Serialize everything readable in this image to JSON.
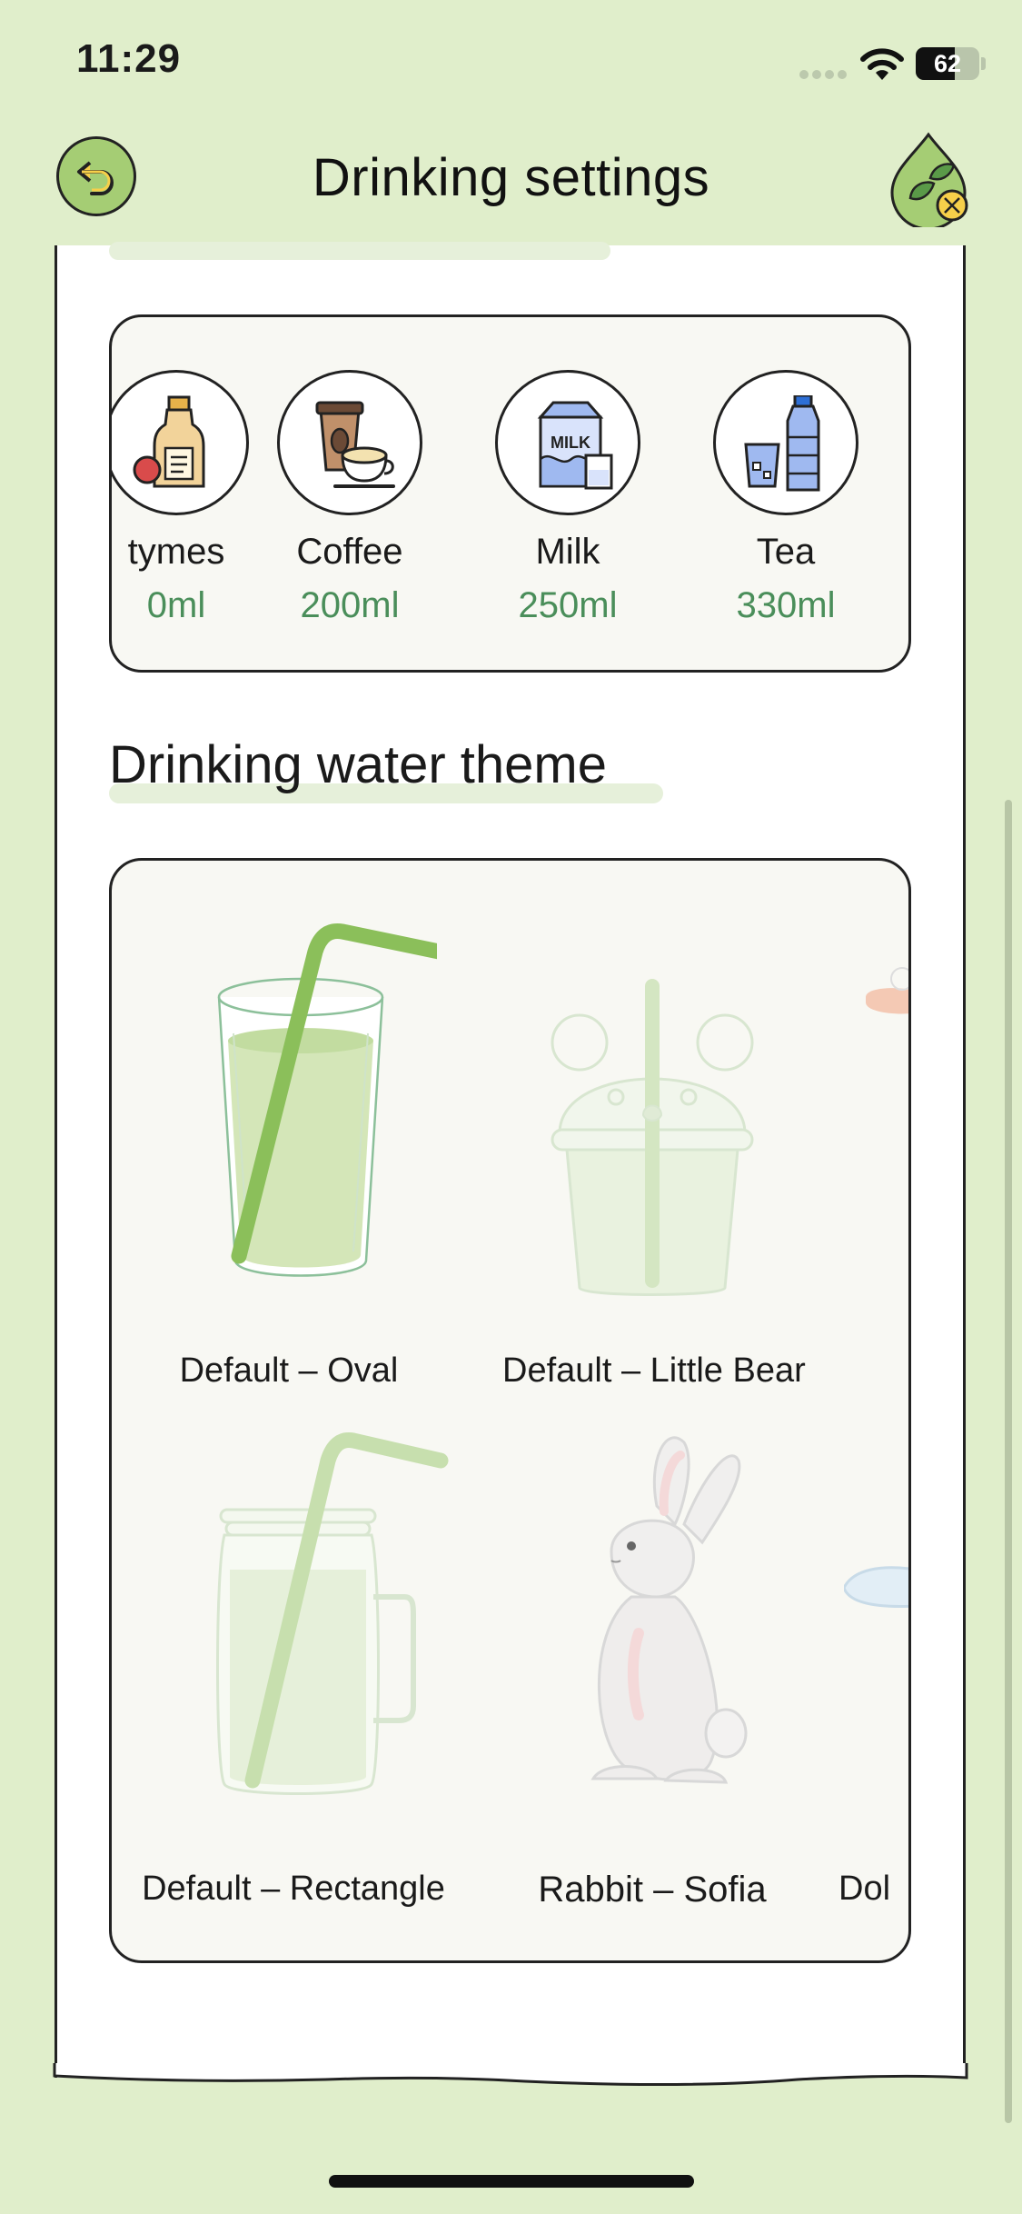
{
  "status_bar": {
    "time": "11:29",
    "battery": "62",
    "battery_level_percent": 62
  },
  "header": {
    "title": "Drinking settings",
    "back_icon": "undo-arrow-icon",
    "right_icon": "water-drop-leaf-icon"
  },
  "drinks": {
    "items": [
      {
        "name": "tymes",
        "amount": "0ml",
        "icon": "bottle-icon"
      },
      {
        "name": "Coffee",
        "amount": "200ml",
        "icon": "coffee-icon"
      },
      {
        "name": "Milk",
        "amount": "250ml",
        "icon": "milk-icon"
      },
      {
        "name": "Tea",
        "amount": "330ml",
        "icon": "water-bottle-icon"
      }
    ]
  },
  "theme_section": {
    "heading": "Drinking water theme",
    "themes": [
      {
        "label": "Default – Oval",
        "selected": true
      },
      {
        "label": "Default – Little Bear",
        "selected": false
      },
      {
        "label": "Default – Rectangle",
        "selected": false
      },
      {
        "label": "Rabbit – Sofia",
        "selected": false
      },
      {
        "label": "Dol",
        "selected": false
      }
    ]
  },
  "colors": {
    "background": "#e0eecb",
    "accent_green": "#4a8e5a",
    "straw_green": "#8bbf5a",
    "back_button": "#a5cd74"
  }
}
